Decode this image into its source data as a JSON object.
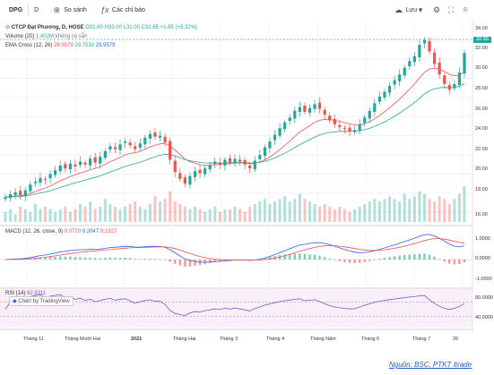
{
  "toolbar": {
    "symbol": "DPG",
    "interval": "D",
    "compare_label": "So sánh",
    "indicators_label": "Các chỉ báo",
    "save_label": "Lưu"
  },
  "legend": {
    "title": "CTCP Đạt Phương, D, HOSE",
    "open": "O31.60",
    "high": "H33.00",
    "low": "L31.00",
    "close": "C32.65",
    "change": "+1.65 (+5.32%)",
    "volume_name": "Volume (20)",
    "volume_value": "1.402M",
    "volume_note": "không có sẵn",
    "ema_name": "EMA Cross (12, 26)",
    "ema_v1": "29.9579",
    "ema_v2": "29.7532",
    "ema_v3": "29.9579"
  },
  "macd": {
    "name": "MACD (12, 26, close, 9)",
    "v1": "0.0720",
    "v2": "0.2047",
    "v3": "0.1327",
    "axis": [
      "1.0000",
      "0.0000",
      "-1.0000"
    ]
  },
  "rsi": {
    "name": "RSI (14)",
    "value": "62.8311",
    "axis": [
      "80.0000",
      "40.0000"
    ]
  },
  "price_axis": [
    "34.00",
    "32.00",
    "30.00",
    "28.00",
    "26.00",
    "24.00",
    "22.00",
    "20.00",
    "18.00",
    "16.00"
  ],
  "price_tag": "32.65",
  "x_axis": [
    "Tháng 11",
    "Tháng Mười Hai",
    "2021",
    "Tháng Hai",
    "Tháng 3",
    "Tháng 4",
    "Tháng Năm",
    "Tháng 6",
    "Tháng 7",
    "26"
  ],
  "watermark": "Chart by TradingView",
  "source": "Nguồn: BSC, PTKT Itrade",
  "chart_data": {
    "type": "candlestick",
    "colors": {
      "up": "#26a69a",
      "down": "#ef5350",
      "ema_fast": "#ef5350",
      "ema_slow": "#26a69a",
      "macd": "#2962ff",
      "signal": "#ef5350",
      "rsi": "#7e57c2"
    },
    "close": [
      17.6,
      17.9,
      18.1,
      17.8,
      18.3,
      18.9,
      19.2,
      19.6,
      19.4,
      20.0,
      20.4,
      20.9,
      20.6,
      21.1,
      20.8,
      21.3,
      21.0,
      21.6,
      21.2,
      21.8,
      22.4,
      22.9,
      22.6,
      23.1,
      23.4,
      23.0,
      22.6,
      23.2,
      23.8,
      24.2,
      23.9,
      24.0,
      23.3,
      21.5,
      20.2,
      19.5,
      19.0,
      19.8,
      20.3,
      20.1,
      20.6,
      20.9,
      21.3,
      21.0,
      21.5,
      21.2,
      21.6,
      21.3,
      21.0,
      20.6,
      21.4,
      22.0,
      22.8,
      23.4,
      24.1,
      24.8,
      25.4,
      25.9,
      26.6,
      27.0,
      26.5,
      26.9,
      27.3,
      26.8,
      26.2,
      25.6,
      25.2,
      24.9,
      24.7,
      24.5,
      24.6,
      25.2,
      25.9,
      26.6,
      27.4,
      28.1,
      28.6,
      29.2,
      29.8,
      30.4,
      31.1,
      31.8,
      32.3,
      33.5,
      34.0,
      32.8,
      31.5,
      30.4,
      29.4,
      28.8,
      29.4,
      30.6,
      32.65
    ],
    "volume": [
      0.4,
      0.5,
      0.3,
      0.6,
      0.5,
      0.4,
      0.7,
      0.5,
      0.6,
      0.5,
      0.4,
      0.5,
      0.6,
      0.4,
      0.5,
      0.7,
      0.6,
      0.8,
      0.5,
      0.6,
      0.9,
      0.7,
      0.6,
      0.5,
      0.6,
      0.7,
      0.8,
      0.6,
      0.5,
      0.7,
      1.0,
      0.8,
      0.9,
      1.2,
      0.8,
      0.7,
      0.6,
      0.5,
      0.6,
      0.5,
      0.4,
      0.5,
      0.6,
      0.4,
      0.5,
      0.5,
      0.6,
      0.5,
      0.4,
      0.6,
      0.7,
      0.8,
      0.9,
      0.7,
      0.8,
      0.9,
      1.0,
      0.8,
      0.9,
      1.1,
      0.9,
      0.8,
      0.7,
      0.6,
      0.7,
      0.6,
      0.5,
      0.6,
      0.5,
      0.4,
      0.5,
      0.6,
      0.7,
      0.8,
      0.9,
      0.8,
      0.9,
      1.0,
      0.9,
      0.8,
      1.1,
      0.9,
      1.0,
      1.2,
      1.1,
      0.9,
      0.8,
      1.0,
      0.9,
      0.7,
      0.9,
      1.1,
      1.4
    ],
    "rsi_range": [
      0,
      100
    ],
    "price_range": [
      15,
      35
    ]
  }
}
